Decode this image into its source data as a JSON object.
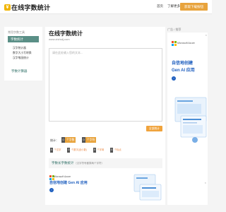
{
  "header": {
    "logo_badge": "¥",
    "logo_text": "在线字数统计",
    "nav_home": "首页",
    "nav_about": "了解更多",
    "top_button": "获取下载按钮"
  },
  "sidebar": {
    "title": "常用字数工具",
    "active_item": "字数统计",
    "sub_items": [
      "汉字统计器",
      "数字大小写转换",
      "汉字笔画统计"
    ],
    "item2": "字数计算器"
  },
  "main": {
    "title": "在线字数统计",
    "url": "www.zishutj.com",
    "textarea_placeholder": "请在此处输入您的文本...",
    "copy_button": "全部统计",
    "stats_label": "统计：",
    "chips": [
      {
        "num": "0",
        "label": "个字数"
      },
      {
        "num": "0",
        "label": "个字符"
      }
    ],
    "details": [
      {
        "num": "0",
        "label": "个汉字"
      },
      {
        "num": "0",
        "label": "个数字(含小数)"
      },
      {
        "num": "0",
        "label": "个字母"
      },
      {
        "num": "0",
        "label": "个标点"
      }
    ],
    "feature_title": "字数长字数统计",
    "feature_note": "（汉字符号都算两个字符）"
  },
  "right_ad": {
    "label": "广告 / 推荐",
    "brand": "Microsoft Azure",
    "headline_1": "自信地创建",
    "headline_2": "Gen AI 应用",
    "arrow": "›",
    "close": "×"
  },
  "bottom_ad": {
    "brand": "Microsoft Azure",
    "title": "自信地创建 Gen AI 应用",
    "arrow": "›",
    "close": "×"
  },
  "colors": {
    "accent": "#e8a33c",
    "sidebar_active": "#5a8f86",
    "ad_blue": "#1f5fbf"
  }
}
